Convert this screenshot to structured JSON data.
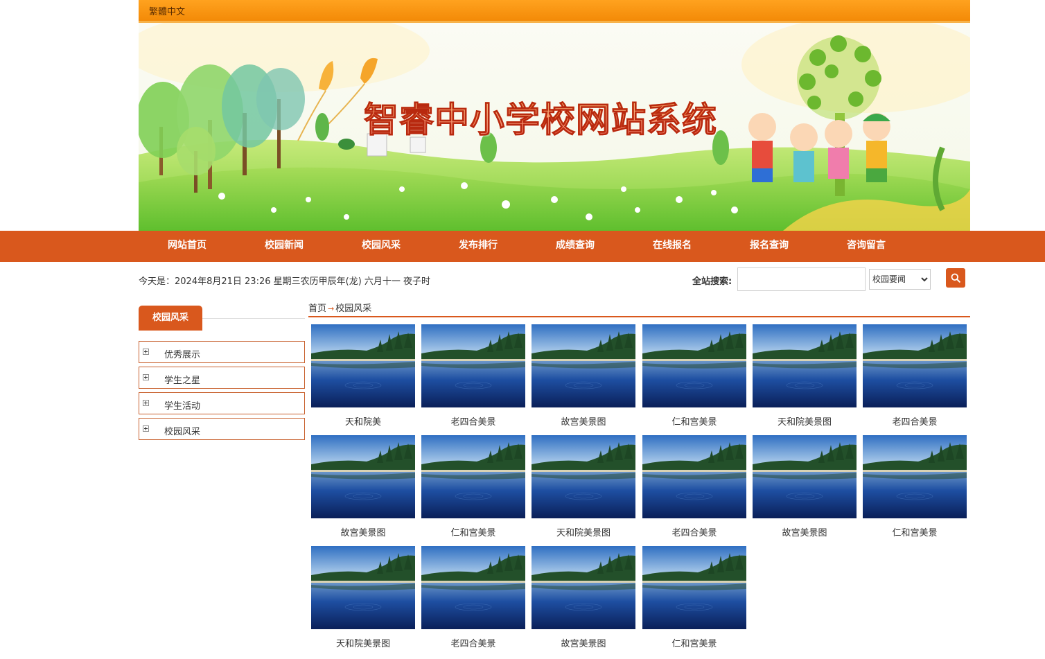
{
  "topbar": {
    "lang_link": "繁體中文"
  },
  "banner": {
    "title": "智睿中小学校网站系统"
  },
  "nav": {
    "items": [
      "网站首页",
      "校园新闻",
      "校园风采",
      "发布排行",
      "成绩查询",
      "在线报名",
      "报名查询",
      "咨询留言"
    ]
  },
  "datebar": {
    "text": "今天是：2024年8月21日 23:26 星期三农历甲辰年(龙) 六月十一 夜子时"
  },
  "search": {
    "label": "全站搜索:",
    "input_value": "",
    "selected_option": "校园要闻"
  },
  "sidebar": {
    "title": "校园风采",
    "items": [
      "优秀展示",
      "学生之星",
      "学生活动",
      "校园风采"
    ]
  },
  "breadcrumb": {
    "home": "首页",
    "current": "校园风采"
  },
  "gallery": {
    "items": [
      "天和院美",
      "老四合美景",
      "故宫美景图",
      "仁和宫美景",
      "天和院美景图",
      "老四合美景",
      "故宫美景图",
      "仁和宫美景",
      "天和院美景图",
      "老四合美景",
      "故宫美景图",
      "仁和宫美景",
      "天和院美景图",
      "老四合美景",
      "故宫美景图",
      "仁和宫美景"
    ]
  },
  "colors": {
    "nav": "#d9581d",
    "topbar": "#f7930f",
    "accent": "#d9581d"
  }
}
